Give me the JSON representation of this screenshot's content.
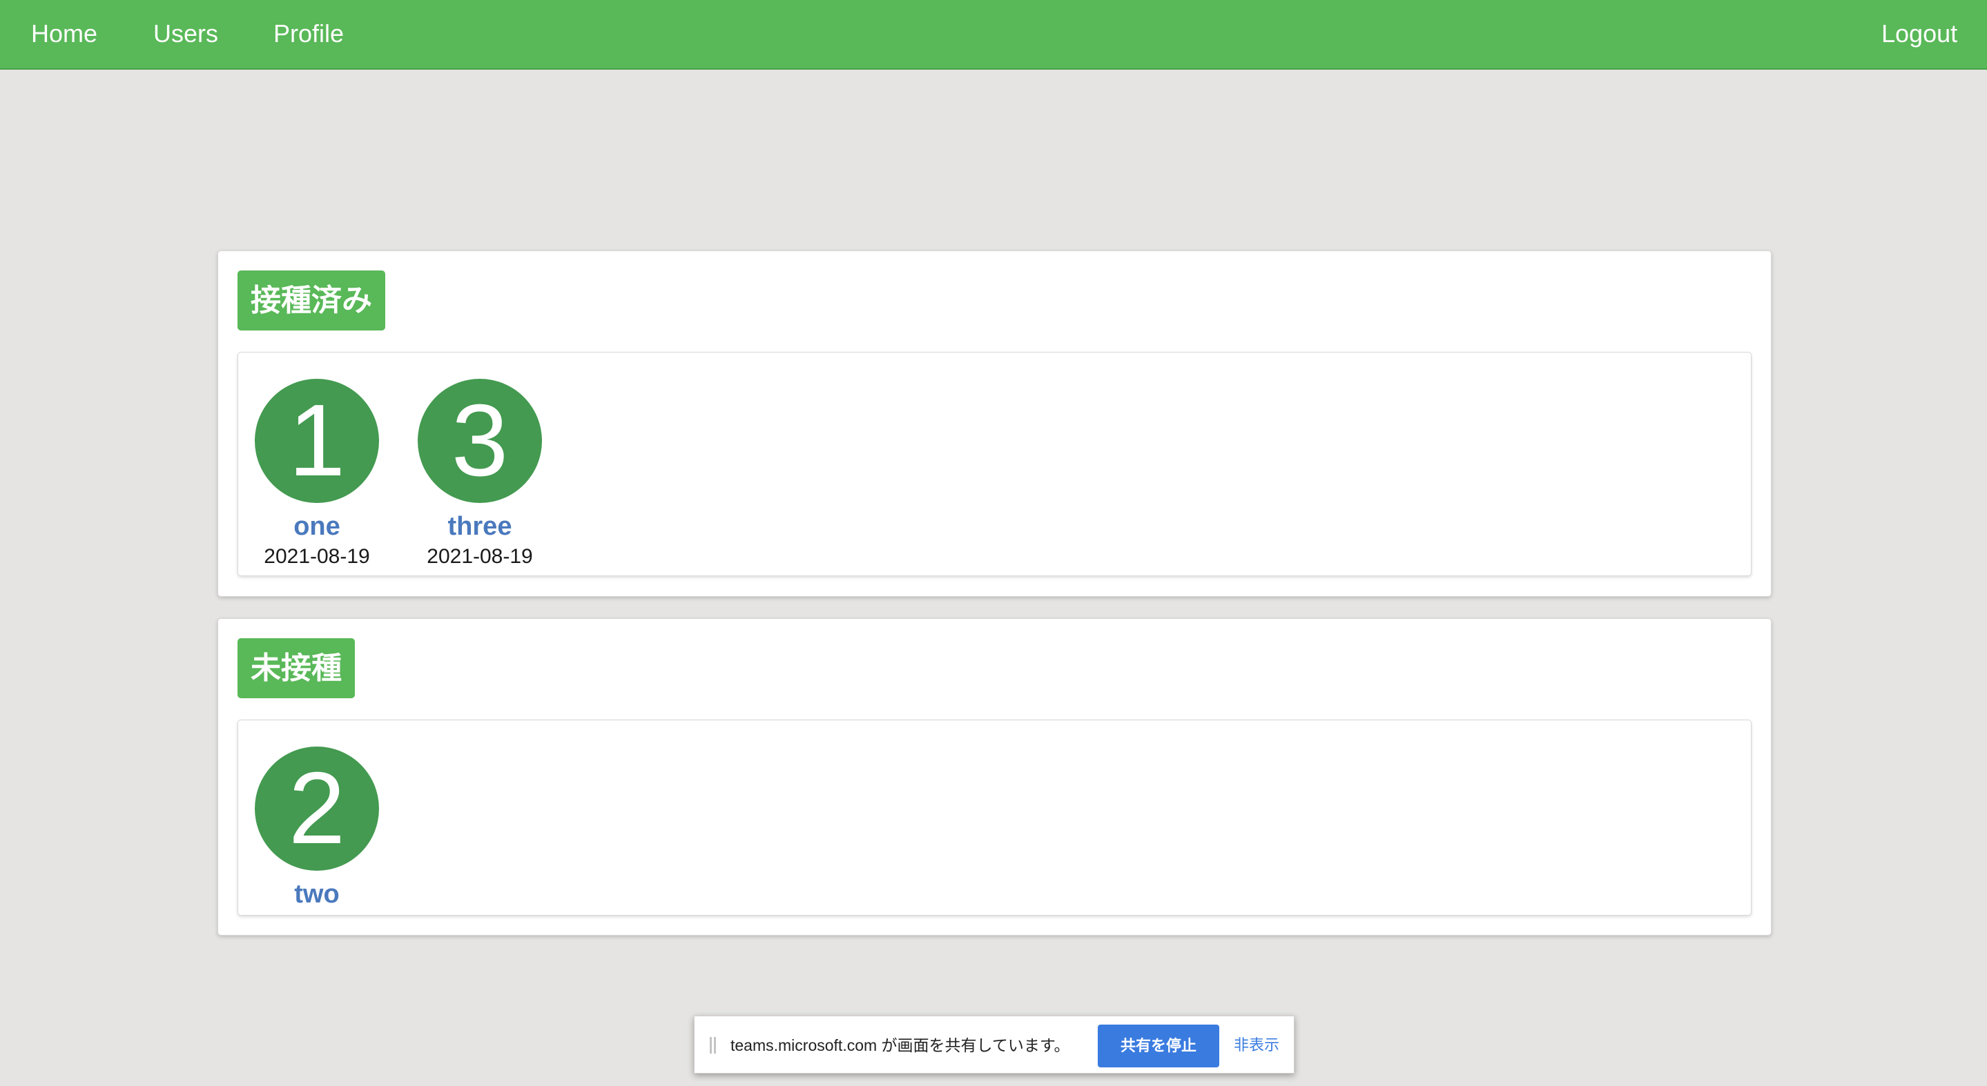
{
  "nav": {
    "home": "Home",
    "users": "Users",
    "profile": "Profile",
    "logout": "Logout"
  },
  "vaccinated": {
    "title": "接種済み",
    "users": [
      {
        "number": "1",
        "name": "one",
        "date": "2021-08-19"
      },
      {
        "number": "3",
        "name": "three",
        "date": "2021-08-19"
      }
    ]
  },
  "unvaccinated": {
    "title": "未接種",
    "users": [
      {
        "number": "2",
        "name": "two"
      }
    ]
  },
  "share_bar": {
    "message": "teams.microsoft.com が画面を共有しています。",
    "stop_label": "共有を停止",
    "hide_label": "非表示"
  },
  "colors": {
    "navbar": "#59b858",
    "badge": "#59b858",
    "avatar": "#439a50",
    "user_link": "#4a79bd",
    "share_button": "#3a7be0",
    "background": "#e5e4e2"
  }
}
